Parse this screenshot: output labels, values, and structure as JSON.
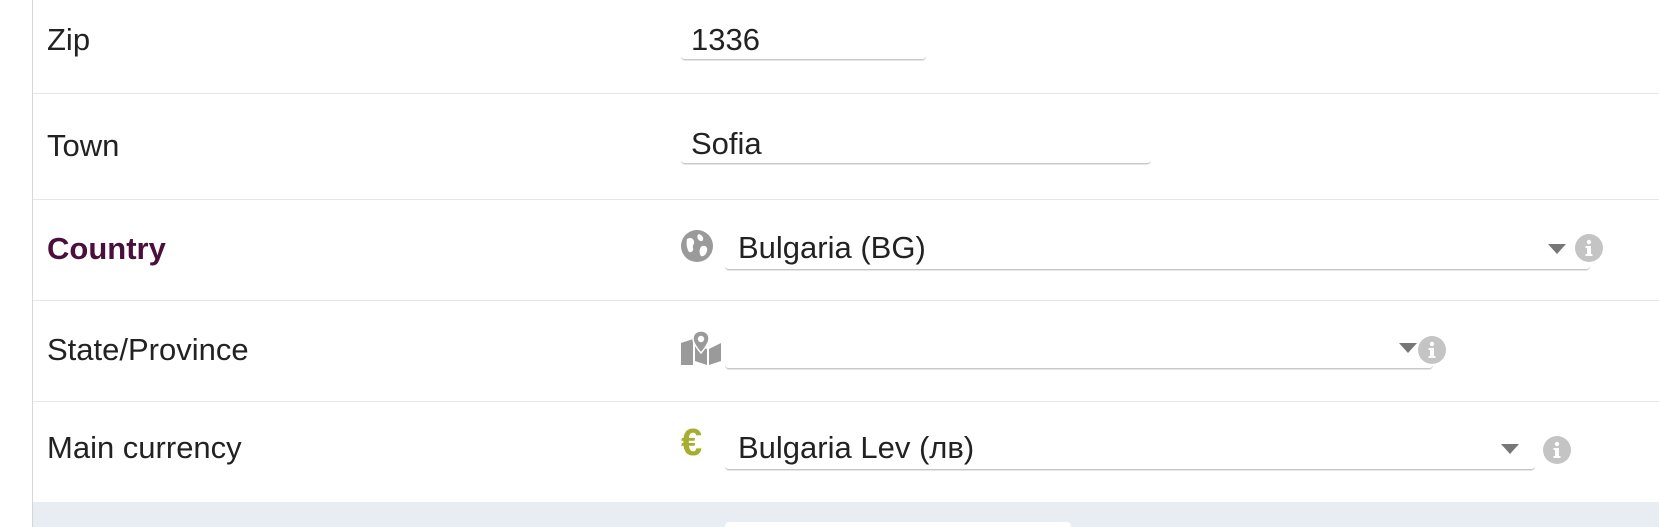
{
  "fields": {
    "zip": {
      "label": "Zip",
      "value": "1336"
    },
    "town": {
      "label": "Town",
      "value": "Sofia"
    },
    "country": {
      "label": "Country",
      "value": "Bulgaria (BG)",
      "icon": "globe-icon",
      "required": true
    },
    "state": {
      "label": "State/Province",
      "value": "",
      "icon": "map-icon"
    },
    "currency": {
      "label": "Main currency",
      "value": "Bulgaria Lev (лв)",
      "icon": "euro-icon"
    }
  },
  "colors": {
    "required_label": "#4a0f3a",
    "icon_gray": "#9a9a9a",
    "euro_icon": "#a6ad2f",
    "row_divider": "#e6e6e6",
    "bottom_band": "#e8edf4"
  }
}
